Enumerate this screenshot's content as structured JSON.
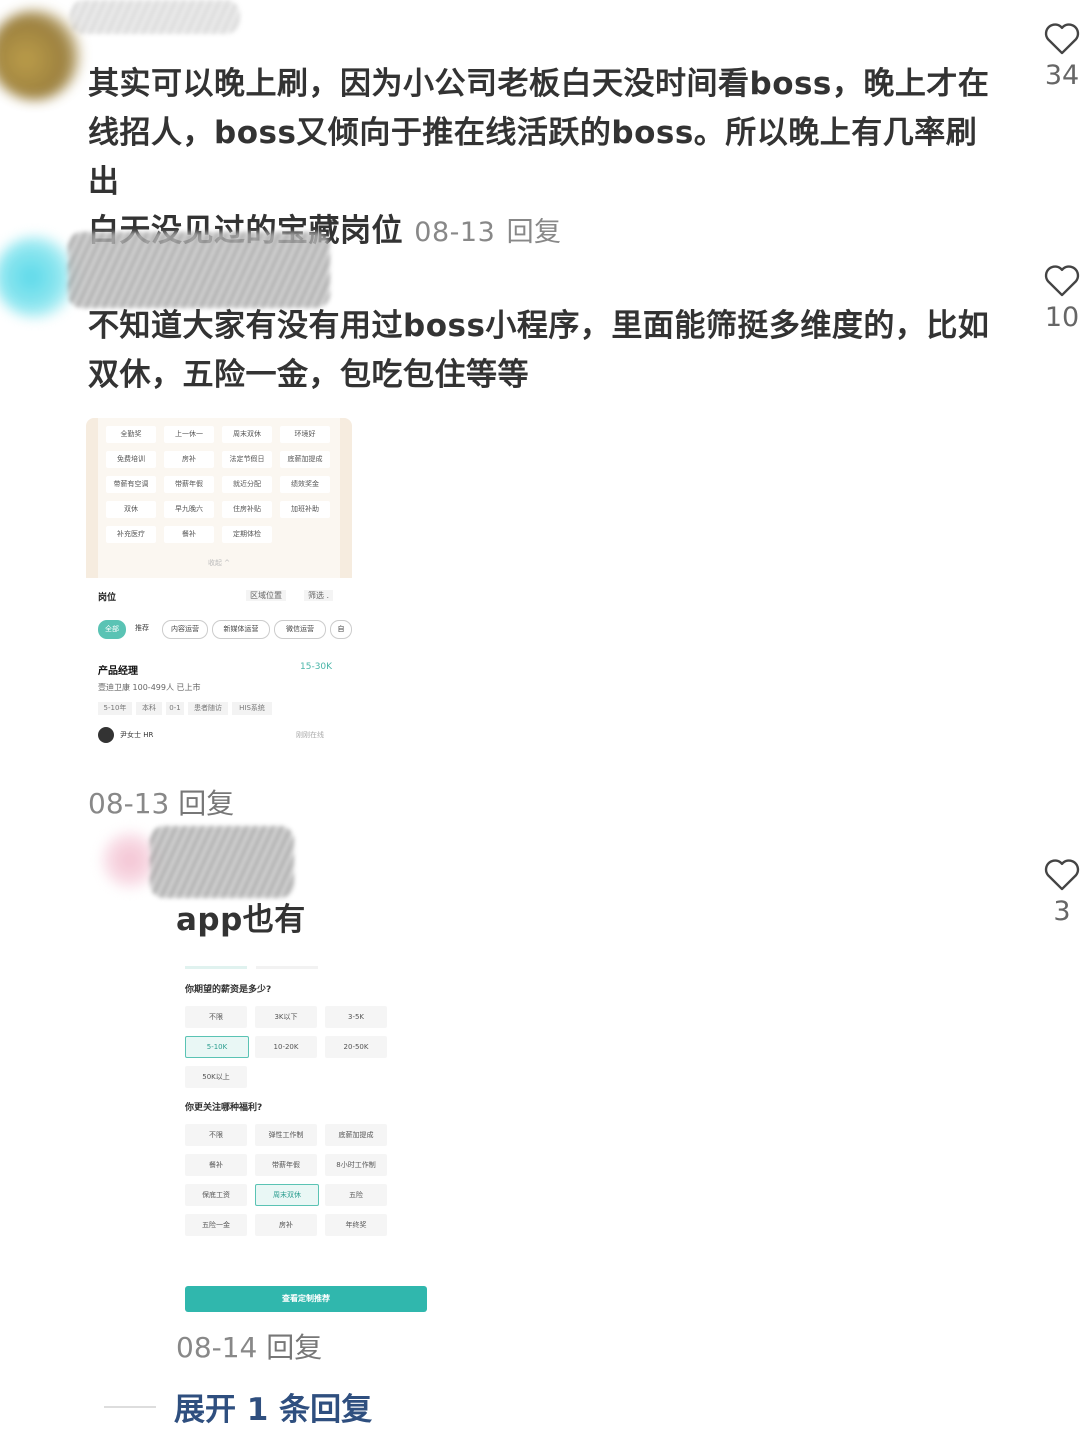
{
  "comments": [
    {
      "text_lines": [
        "其实可以晚上刷，因为小公司老板白天没时间看boss，晚上才在",
        "线招人，boss又倾向于推在线活跃的boss。所以晚上有几率刷出",
        "白天没见过的宝藏岗位"
      ],
      "date": "08-13",
      "reply_label": "回复",
      "likes": "34"
    },
    {
      "text_lines": [
        "不知道大家有没有用过boss小程序，里面能筛挺多维度的，比如",
        "双休，五险一金，包吃包住等等"
      ],
      "date": "08-13",
      "reply_label": "回复",
      "likes": "10",
      "screenshot": {
        "chips": [
          [
            "全勤奖",
            "上一休一",
            "周末双休",
            "环境好"
          ],
          [
            "免费培训",
            "房补",
            "法定节假日",
            "底薪加提成"
          ],
          [
            "带薪有空调",
            "带薪年假",
            "就近分配",
            "绩效奖金"
          ],
          [
            "双休",
            "早九晚六",
            "住房补贴",
            "加班补助"
          ],
          [
            "补充医疗",
            "餐补",
            "定期体检"
          ]
        ],
        "collapse_label": "收起 ^",
        "section_title": "岗位",
        "filter_area": "区域位置",
        "filter_screen": "筛选 .",
        "tabs": [
          "全部",
          "推荐",
          "内容运营",
          "新媒体运营",
          "微信运营",
          "自"
        ],
        "job_title": "产品经理",
        "job_salary": "15-30K",
        "company_line": "壹迪卫康   100-499人   已上市",
        "job_tags": [
          "5-10年",
          "本科",
          "0-1",
          "患者随访",
          "HIS系统"
        ],
        "recruiter": "尹女士 HR",
        "recruiter_status": "刚刚在线"
      }
    },
    {
      "text_lines": [
        "app也有"
      ],
      "date": "08-14",
      "reply_label": "回复",
      "likes": "3",
      "screenshot": {
        "q1": "你期望的薪资是多少?",
        "salary_options": [
          "不限",
          "3K以下",
          "3-5K",
          "5-10K",
          "10-20K",
          "20-50K",
          "50K以上"
        ],
        "q2": "你更关注哪种福利?",
        "welfare_options": [
          "不限",
          "弹性工作制",
          "底薪加提成",
          "餐补",
          "带薪年假",
          "8小时工作制",
          "保底工资",
          "周末双休",
          "五险",
          "五险一金",
          "房补",
          "年终奖"
        ],
        "cta": "查看定制推荐"
      }
    }
  ],
  "expand_replies": "展开 1 条回复",
  "colors": {
    "accent": "#30b7ad",
    "link": "#2f4f7f"
  },
  "icons": {
    "like": "heart-outline-icon"
  }
}
